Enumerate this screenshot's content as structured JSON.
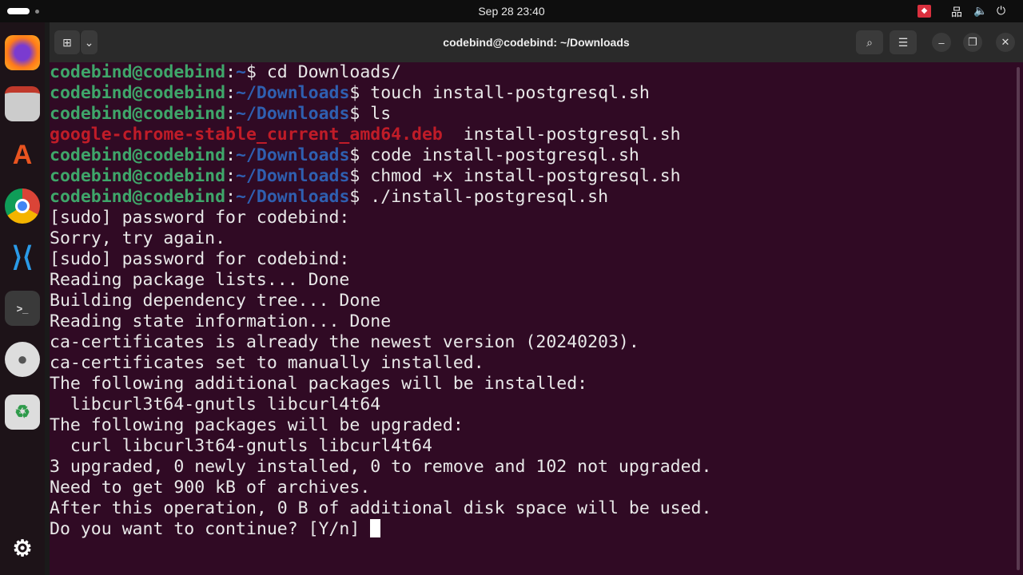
{
  "topbar": {
    "clock": "Sep 28  23:40",
    "tray_icons": [
      "anydesk-icon",
      "network-icon",
      "volume-icon",
      "power-icon"
    ]
  },
  "dock": {
    "items": [
      "firefox",
      "files",
      "app-center",
      "chrome",
      "vscode",
      "terminal",
      "dvd",
      "trash",
      "show-apps"
    ]
  },
  "window": {
    "title": "codebind@codebind: ~/Downloads"
  },
  "terminal": {
    "lines": [
      [
        {
          "c": "g",
          "t": "codebind@codebind"
        },
        {
          "t": ":"
        },
        {
          "c": "b",
          "t": "~"
        },
        {
          "t": "$ cd Downloads/"
        }
      ],
      [
        {
          "c": "g",
          "t": "codebind@codebind"
        },
        {
          "t": ":"
        },
        {
          "c": "b",
          "t": "~/Downloads"
        },
        {
          "t": "$ touch install-postgresql.sh"
        }
      ],
      [
        {
          "c": "g",
          "t": "codebind@codebind"
        },
        {
          "t": ":"
        },
        {
          "c": "b",
          "t": "~/Downloads"
        },
        {
          "t": "$ ls"
        }
      ],
      [
        {
          "c": "r",
          "t": "google-chrome-stable_current_amd64.deb"
        },
        {
          "t": "  install-postgresql.sh"
        }
      ],
      [
        {
          "c": "g",
          "t": "codebind@codebind"
        },
        {
          "t": ":"
        },
        {
          "c": "b",
          "t": "~/Downloads"
        },
        {
          "t": "$ code install-postgresql.sh"
        }
      ],
      [
        {
          "c": "g",
          "t": "codebind@codebind"
        },
        {
          "t": ":"
        },
        {
          "c": "b",
          "t": "~/Downloads"
        },
        {
          "t": "$ chmod +x install-postgresql.sh"
        }
      ],
      [
        {
          "c": "g",
          "t": "codebind@codebind"
        },
        {
          "t": ":"
        },
        {
          "c": "b",
          "t": "~/Downloads"
        },
        {
          "t": "$ ./install-postgresql.sh"
        }
      ],
      [
        {
          "t": "[sudo] password for codebind:"
        }
      ],
      [
        {
          "t": "Sorry, try again."
        }
      ],
      [
        {
          "t": "[sudo] password for codebind:"
        }
      ],
      [
        {
          "t": "Reading package lists... Done"
        }
      ],
      [
        {
          "t": "Building dependency tree... Done"
        }
      ],
      [
        {
          "t": "Reading state information... Done"
        }
      ],
      [
        {
          "t": "ca-certificates is already the newest version (20240203)."
        }
      ],
      [
        {
          "t": "ca-certificates set to manually installed."
        }
      ],
      [
        {
          "t": "The following additional packages will be installed:"
        }
      ],
      [
        {
          "t": "  libcurl3t64-gnutls libcurl4t64"
        }
      ],
      [
        {
          "t": "The following packages will be upgraded:"
        }
      ],
      [
        {
          "t": "  curl libcurl3t64-gnutls libcurl4t64"
        }
      ],
      [
        {
          "t": "3 upgraded, 0 newly installed, 0 to remove and 102 not upgraded."
        }
      ],
      [
        {
          "t": "Need to get 900 kB of archives."
        }
      ],
      [
        {
          "t": "After this operation, 0 B of additional disk space will be used."
        }
      ],
      [
        {
          "t": "Do you want to continue? [Y/n] "
        }
      ]
    ]
  }
}
